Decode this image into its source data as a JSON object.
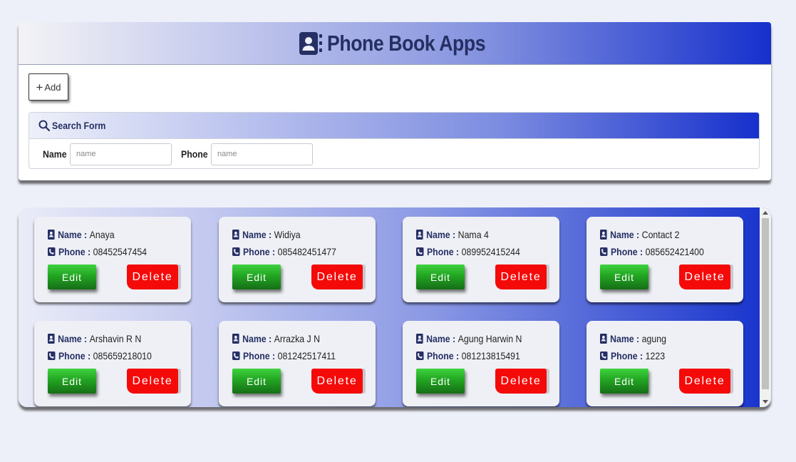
{
  "header": {
    "title": "Phone Book Apps"
  },
  "toolbar": {
    "add_label": "Add"
  },
  "search": {
    "title": "Search Form",
    "name_label": "Name",
    "name_placeholder": "name",
    "phone_label": "Phone",
    "phone_placeholder": "name"
  },
  "card_labels": {
    "name": "Name :",
    "phone": "Phone :",
    "edit": "Edit",
    "delete": "Delete"
  },
  "contacts": [
    {
      "name": "Anaya",
      "phone": "08452547454"
    },
    {
      "name": "Widiya",
      "phone": "085482451477"
    },
    {
      "name": "Nama 4",
      "phone": "089952415244"
    },
    {
      "name": "Contact 2",
      "phone": "085652421400"
    },
    {
      "name": "Arshavin R N",
      "phone": "085659218010"
    },
    {
      "name": "Arrazka J N",
      "phone": "081242517411"
    },
    {
      "name": "Agung Harwin N",
      "phone": "081213815491"
    },
    {
      "name": "agung",
      "phone": "1223"
    }
  ],
  "colors": {
    "title_text": "#262f63",
    "accent_blue": "#1630cc",
    "edit_green": "#22a522",
    "delete_red": "#f50a0a"
  },
  "icons": {
    "header": "contact-book-icon",
    "add": "plus-icon",
    "search": "search-icon",
    "name": "contact-card-icon",
    "phone": "phone-icon"
  }
}
